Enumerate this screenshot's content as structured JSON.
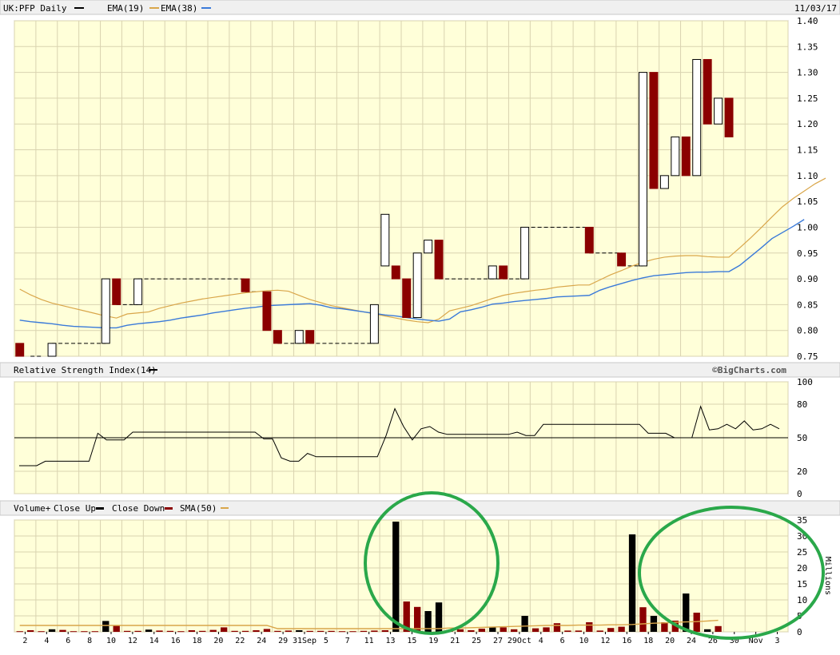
{
  "colors": {
    "background": "#ffffd9",
    "header_bg": "#f0f0f0",
    "grid": "#d9d3b0",
    "up": "#ffffff",
    "down": "#8b0000",
    "outline": "#000000",
    "ema19": "#d9a64a",
    "ema38": "#3a7ad9",
    "sma50": "#d9a64a",
    "annotation": "#2aa84a"
  },
  "chart_data": [
    {
      "type": "candlestick",
      "title": "UK:PFP Daily",
      "date_label": "11/03/17",
      "legend": [
        "EMA(19)",
        "EMA(38)"
      ],
      "ylim": [
        0.75,
        1.4
      ],
      "yticks": [
        "0.75",
        "0.80",
        "0.85",
        "0.90",
        "0.95",
        "1.00",
        "1.05",
        "1.10",
        "1.15",
        "1.20",
        "1.25",
        "1.30",
        "1.35",
        "1.40"
      ],
      "bars": [
        {
          "open": 0.775,
          "close": 0.75
        },
        {
          "open": 0.75,
          "close": 0.75
        },
        {
          "open": 0.75,
          "close": 0.75
        },
        {
          "open": 0.75,
          "close": 0.775
        },
        {
          "open": 0.775,
          "close": 0.775
        },
        {
          "open": 0.775,
          "close": 0.775
        },
        {
          "open": 0.775,
          "close": 0.775
        },
        {
          "open": 0.775,
          "close": 0.775
        },
        {
          "open": 0.775,
          "close": 0.9
        },
        {
          "open": 0.9,
          "close": 0.85
        },
        {
          "open": 0.85,
          "close": 0.85
        },
        {
          "open": 0.85,
          "close": 0.9
        },
        {
          "open": 0.9,
          "close": 0.9
        },
        {
          "open": 0.9,
          "close": 0.9
        },
        {
          "open": 0.9,
          "close": 0.9
        },
        {
          "open": 0.9,
          "close": 0.9
        },
        {
          "open": 0.9,
          "close": 0.9
        },
        {
          "open": 0.9,
          "close": 0.9
        },
        {
          "open": 0.9,
          "close": 0.9
        },
        {
          "open": 0.9,
          "close": 0.9
        },
        {
          "open": 0.9,
          "close": 0.9
        },
        {
          "open": 0.9,
          "close": 0.875
        },
        {
          "open": 0.875,
          "close": 0.875
        },
        {
          "open": 0.875,
          "close": 0.8
        },
        {
          "open": 0.8,
          "close": 0.775
        },
        {
          "open": 0.775,
          "close": 0.775
        },
        {
          "open": 0.775,
          "close": 0.8
        },
        {
          "open": 0.8,
          "close": 0.775
        },
        {
          "open": 0.775,
          "close": 0.775
        },
        {
          "open": 0.775,
          "close": 0.775
        },
        {
          "open": 0.775,
          "close": 0.775
        },
        {
          "open": 0.775,
          "close": 0.775
        },
        {
          "open": 0.775,
          "close": 0.775
        },
        {
          "open": 0.775,
          "close": 0.85
        },
        {
          "open": 0.925,
          "close": 1.025
        },
        {
          "open": 0.925,
          "close": 0.9
        },
        {
          "open": 0.9,
          "close": 0.825
        },
        {
          "open": 0.825,
          "close": 0.95
        },
        {
          "open": 0.95,
          "close": 0.975
        },
        {
          "open": 0.975,
          "close": 0.9
        },
        {
          "open": 0.9,
          "close": 0.9
        },
        {
          "open": 0.9,
          "close": 0.9
        },
        {
          "open": 0.9,
          "close": 0.9
        },
        {
          "open": 0.9,
          "close": 0.9
        },
        {
          "open": 0.9,
          "close": 0.925
        },
        {
          "open": 0.925,
          "close": 0.9
        },
        {
          "open": 0.9,
          "close": 0.9
        },
        {
          "open": 0.9,
          "close": 1.0
        },
        {
          "open": 1.0,
          "close": 1.0
        },
        {
          "open": 1.0,
          "close": 1.0
        },
        {
          "open": 1.0,
          "close": 1.0
        },
        {
          "open": 1.0,
          "close": 1.0
        },
        {
          "open": 1.0,
          "close": 1.0
        },
        {
          "open": 1.0,
          "close": 0.95
        },
        {
          "open": 0.95,
          "close": 0.95
        },
        {
          "open": 0.95,
          "close": 0.95
        },
        {
          "open": 0.95,
          "close": 0.925
        },
        {
          "open": 0.925,
          "close": 0.925
        },
        {
          "open": 0.925,
          "close": 1.3
        },
        {
          "open": 1.3,
          "close": 1.075
        },
        {
          "open": 1.075,
          "close": 1.1
        },
        {
          "open": 1.1,
          "close": 1.175
        },
        {
          "open": 1.175,
          "close": 1.1
        },
        {
          "open": 1.1,
          "close": 1.325
        },
        {
          "open": 1.325,
          "close": 1.2
        },
        {
          "open": 1.2,
          "close": 1.25
        },
        {
          "open": 1.25,
          "close": 1.175
        }
      ],
      "ema19": [
        0.88,
        0.869,
        0.86,
        0.853,
        0.848,
        0.843,
        0.838,
        0.833,
        0.828,
        0.824,
        0.832,
        0.834,
        0.836,
        0.843,
        0.848,
        0.853,
        0.857,
        0.861,
        0.864,
        0.867,
        0.87,
        0.873,
        0.875,
        0.877,
        0.878,
        0.876,
        0.868,
        0.86,
        0.854,
        0.848,
        0.844,
        0.84,
        0.836,
        0.832,
        0.828,
        0.824,
        0.82,
        0.817,
        0.815,
        0.822,
        0.838,
        0.843,
        0.848,
        0.855,
        0.862,
        0.868,
        0.872,
        0.875,
        0.878,
        0.88,
        0.884,
        0.886,
        0.888,
        0.888,
        0.898,
        0.908,
        0.916,
        0.925,
        0.932,
        0.938,
        0.942,
        0.944,
        0.945,
        0.945,
        0.943,
        0.942,
        0.942,
        0.96,
        0.979,
        0.999,
        1.02,
        1.04,
        1.056,
        1.07,
        1.084,
        1.095
      ],
      "ema38": [
        0.82,
        0.817,
        0.815,
        0.813,
        0.81,
        0.808,
        0.807,
        0.806,
        0.805,
        0.805,
        0.81,
        0.813,
        0.815,
        0.817,
        0.82,
        0.824,
        0.827,
        0.83,
        0.834,
        0.837,
        0.84,
        0.843,
        0.845,
        0.848,
        0.849,
        0.85,
        0.851,
        0.852,
        0.849,
        0.844,
        0.842,
        0.839,
        0.836,
        0.833,
        0.83,
        0.828,
        0.825,
        0.822,
        0.82,
        0.818,
        0.822,
        0.836,
        0.84,
        0.845,
        0.851,
        0.853,
        0.856,
        0.858,
        0.86,
        0.862,
        0.865,
        0.866,
        0.867,
        0.868,
        0.878,
        0.885,
        0.891,
        0.897,
        0.902,
        0.906,
        0.908,
        0.91,
        0.912,
        0.913,
        0.913,
        0.914,
        0.914,
        0.926,
        0.943,
        0.96,
        0.978,
        0.99,
        1.002,
        1.015
      ],
      "dashed_segments": [
        {
          "from": 1,
          "to": 2,
          "value": 0.75
        },
        {
          "from": 3,
          "to": 8,
          "value": 0.775
        },
        {
          "from": 9,
          "to": 11,
          "value": 0.85
        },
        {
          "from": 11,
          "to": 21,
          "value": 0.9
        },
        {
          "from": 21,
          "to": 22,
          "value": 0.875
        },
        {
          "from": 24,
          "to": 33,
          "value": 0.775
        },
        {
          "from": 39,
          "to": 47,
          "value": 0.9
        },
        {
          "from": 47,
          "to": 53,
          "value": 1.0
        },
        {
          "from": 53,
          "to": 56,
          "value": 0.95
        },
        {
          "from": 56,
          "to": 58,
          "value": 0.925
        }
      ]
    },
    {
      "type": "line",
      "title": "Relative Strength Index(14)",
      "brand": "©BigCharts.com",
      "ylim": [
        0,
        100
      ],
      "yticks": [
        "0",
        "20",
        "50",
        "80",
        "100"
      ],
      "values": [
        25,
        25,
        25,
        29,
        29,
        29,
        29,
        29,
        29,
        54,
        48,
        48,
        48,
        55,
        55,
        55,
        55,
        55,
        55,
        55,
        55,
        55,
        55,
        55,
        55,
        55,
        55,
        55,
        49,
        49,
        32,
        29,
        29,
        36,
        33,
        33,
        33,
        33,
        33,
        33,
        33,
        33,
        52,
        76,
        60,
        48,
        58,
        60,
        55,
        53,
        53,
        53,
        53,
        53,
        53,
        53,
        53,
        55,
        52,
        52,
        62,
        62,
        62,
        62,
        62,
        62,
        62,
        62,
        62,
        62,
        62,
        62,
        54,
        54,
        54,
        50,
        50,
        50,
        78,
        57,
        58,
        62,
        58,
        65,
        57,
        58,
        62,
        58
      ]
    },
    {
      "type": "bar",
      "title": "Volume+",
      "legend": [
        "Close Up",
        "Close Down",
        "SMA(50)"
      ],
      "ylabel": "Millions",
      "ylim": [
        0,
        35
      ],
      "yticks": [
        "0",
        "5",
        "10",
        "15",
        "20",
        "25",
        "30",
        "35"
      ],
      "categories": [
        "2",
        "4",
        "6",
        "8",
        "10",
        "12",
        "14",
        "16",
        "18",
        "20",
        "22",
        "24",
        "29",
        "31Sep",
        "5",
        "7",
        "11",
        "13",
        "15",
        "19",
        "21",
        "25",
        "27",
        "29Oct",
        "4",
        "6",
        "10",
        "12",
        "16",
        "18",
        "20",
        "24",
        "26",
        "30",
        "Nov",
        "3"
      ],
      "category_index": [
        1,
        3,
        5,
        7,
        9,
        11,
        13,
        15,
        17,
        19,
        21,
        23,
        25,
        27,
        29,
        31,
        33,
        35,
        37,
        39,
        41,
        43,
        45,
        47,
        49,
        51,
        53,
        55,
        57,
        59,
        61,
        63,
        65,
        67,
        69,
        71
      ],
      "volumes": [
        {
          "v": 0.2,
          "up": false
        },
        {
          "v": 0.5,
          "up": false
        },
        {
          "v": 0.2,
          "up": false
        },
        {
          "v": 0.8,
          "up": true
        },
        {
          "v": 0.6,
          "up": false
        },
        {
          "v": 0.2,
          "up": false
        },
        {
          "v": 0.2,
          "up": false
        },
        {
          "v": 0.2,
          "up": false
        },
        {
          "v": 3.4,
          "up": true
        },
        {
          "v": 2.0,
          "up": false
        },
        {
          "v": 0.3,
          "up": false
        },
        {
          "v": 0.3,
          "up": false
        },
        {
          "v": 0.7,
          "up": true
        },
        {
          "v": 0.4,
          "up": false
        },
        {
          "v": 0.3,
          "up": false
        },
        {
          "v": 0.2,
          "up": false
        },
        {
          "v": 0.5,
          "up": false
        },
        {
          "v": 0.3,
          "up": false
        },
        {
          "v": 0.6,
          "up": false
        },
        {
          "v": 1.4,
          "up": false
        },
        {
          "v": 0.3,
          "up": false
        },
        {
          "v": 0.3,
          "up": false
        },
        {
          "v": 0.5,
          "up": false
        },
        {
          "v": 0.9,
          "up": false
        },
        {
          "v": 0.3,
          "up": false
        },
        {
          "v": 0.4,
          "up": false
        },
        {
          "v": 0.5,
          "up": true
        },
        {
          "v": 0.3,
          "up": false
        },
        {
          "v": 0.3,
          "up": false
        },
        {
          "v": 0.3,
          "up": false
        },
        {
          "v": 0.2,
          "up": false
        },
        {
          "v": 0.2,
          "up": false
        },
        {
          "v": 0.3,
          "up": false
        },
        {
          "v": 0.4,
          "up": false
        },
        {
          "v": 0.5,
          "up": false
        },
        {
          "v": 34.5,
          "up": true
        },
        {
          "v": 9.5,
          "up": false
        },
        {
          "v": 7.8,
          "up": false
        },
        {
          "v": 6.5,
          "up": true
        },
        {
          "v": 9.2,
          "up": true
        },
        {
          "v": 0.6,
          "up": false
        },
        {
          "v": 0.8,
          "up": false
        },
        {
          "v": 0.5,
          "up": false
        },
        {
          "v": 1.0,
          "up": false
        },
        {
          "v": 1.6,
          "up": true
        },
        {
          "v": 1.4,
          "up": false
        },
        {
          "v": 0.8,
          "up": false
        },
        {
          "v": 5.0,
          "up": true
        },
        {
          "v": 1.1,
          "up": false
        },
        {
          "v": 1.4,
          "up": false
        },
        {
          "v": 2.7,
          "up": false
        },
        {
          "v": 0.4,
          "up": false
        },
        {
          "v": 0.4,
          "up": false
        },
        {
          "v": 3.0,
          "up": false
        },
        {
          "v": 0.4,
          "up": false
        },
        {
          "v": 1.2,
          "up": false
        },
        {
          "v": 1.6,
          "up": false
        },
        {
          "v": 30.5,
          "up": true
        },
        {
          "v": 7.7,
          "up": false
        },
        {
          "v": 5.0,
          "up": true
        },
        {
          "v": 3.0,
          "up": false
        },
        {
          "v": 3.5,
          "up": false
        },
        {
          "v": 12.0,
          "up": true
        },
        {
          "v": 6.0,
          "up": false
        },
        {
          "v": 0.8,
          "up": true
        },
        {
          "v": 1.8,
          "up": false
        }
      ],
      "sma50": [
        2.0,
        2.0,
        2.0,
        2.0,
        2.0,
        2.0,
        2.0,
        2.0,
        2.0,
        2.0,
        2.0,
        2.0,
        2.0,
        2.0,
        2.0,
        2.0,
        2.0,
        2.0,
        2.0,
        2.0,
        2.0,
        2.0,
        2.0,
        2.0,
        1.0,
        1.0,
        1.0,
        1.0,
        1.0,
        1.0,
        1.0,
        1.0,
        1.0,
        1.0,
        1.0,
        1.0,
        1.0,
        1.0,
        1.0,
        1.0,
        1.2,
        1.2,
        1.3,
        1.4,
        1.5,
        1.6,
        1.7,
        1.8,
        1.9,
        2.0,
        2.0,
        2.0,
        2.1,
        2.1,
        2.1,
        2.2,
        2.2,
        2.3,
        2.5,
        2.7,
        2.8,
        3.0,
        3.1,
        3.2,
        3.4,
        3.6
      ]
    }
  ]
}
